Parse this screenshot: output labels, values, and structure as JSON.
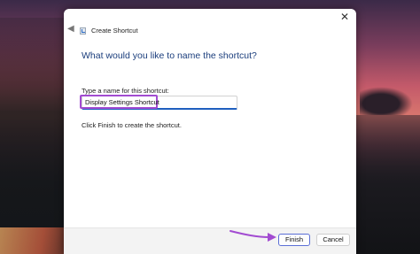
{
  "window": {
    "title": "Create Shortcut",
    "close_symbol": "✕"
  },
  "heading": "What would you like to name the shortcut?",
  "name_field": {
    "label": "Type a name for this shortcut:",
    "value": "Display Settings Shortcut"
  },
  "hint": "Click Finish to create the shortcut.",
  "buttons": {
    "finish": "Finish",
    "cancel": "Cancel"
  },
  "icons": {
    "back": "back-arrow-icon",
    "app": "shortcut-icon",
    "close": "close-icon",
    "annotation": "purple-pointer-arrow"
  },
  "colors": {
    "heading": "#1a3d7c",
    "input_focus": "#1f5fbf",
    "annotation": "#a24bd1"
  }
}
